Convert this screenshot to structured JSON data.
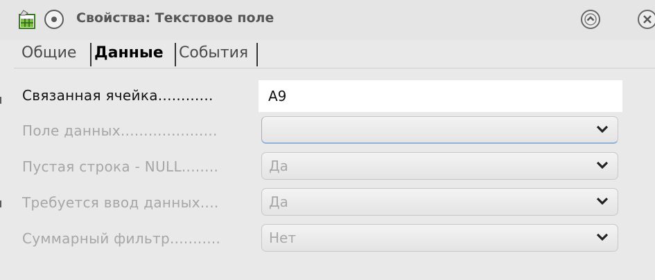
{
  "window": {
    "title": "Свойства: Текстовое поле",
    "icons": [
      "spreadsheet-app-icon",
      "window-menu-icon",
      "roll-up-icon",
      "close-icon"
    ]
  },
  "tabs": [
    {
      "label": "Общие",
      "active": false
    },
    {
      "label": "Данные",
      "active": true
    },
    {
      "label": "События",
      "active": false
    }
  ],
  "fields": {
    "linked_cell": {
      "label": "Связанная ячейка............",
      "value": "A9",
      "enabled": true
    },
    "data_field": {
      "label": "Поле данных.....................",
      "value": "",
      "enabled": false
    },
    "empty_null": {
      "label": "Пустая строка - NULL........",
      "value": "Да",
      "enabled": false
    },
    "input_required": {
      "label": "Требуется ввод данных....",
      "value": "Да",
      "enabled": false
    },
    "total_filter": {
      "label": "Суммарный фильтр...........",
      "value": "Нет",
      "enabled": false
    }
  },
  "colors": {
    "background": "#e9e9e9",
    "disabled_text": "#a6a6a6",
    "focus": "#8fb2d6"
  }
}
